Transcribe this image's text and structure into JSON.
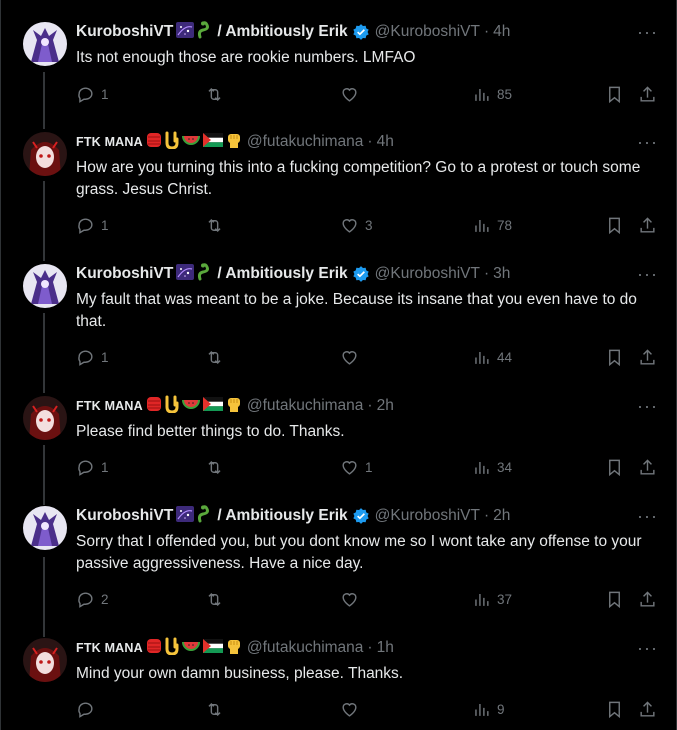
{
  "tweets": [
    {
      "author": "KuroboshiVT",
      "author_suffix": "/ Ambitiously Erik",
      "handle": "@KuroboshiVT",
      "time": "4h",
      "text": "Its not enough those are rookie numbers. LMFAO",
      "replies": "1",
      "retweets": "",
      "likes": "",
      "views": "85"
    },
    {
      "author": "FTK MANA",
      "author_suffix": "",
      "handle": "@futakuchimana",
      "time": "4h",
      "text": "How are you turning this into a fucking competition? Go to a protest or touch some grass. Jesus Christ.",
      "replies": "1",
      "retweets": "",
      "likes": "3",
      "views": "78"
    },
    {
      "author": "KuroboshiVT",
      "author_suffix": "/ Ambitiously Erik",
      "handle": "@KuroboshiVT",
      "time": "3h",
      "text": "My fault that was meant to be a joke. Because its insane that you even have to do that.",
      "replies": "1",
      "retweets": "",
      "likes": "",
      "views": "44"
    },
    {
      "author": "FTK MANA",
      "author_suffix": "",
      "handle": "@futakuchimana",
      "time": "2h",
      "text": "Please find better things to do. Thanks.",
      "replies": "1",
      "retweets": "",
      "likes": "1",
      "views": "34"
    },
    {
      "author": "KuroboshiVT",
      "author_suffix": "/ Ambitiously Erik",
      "handle": "@KuroboshiVT",
      "time": "2h",
      "text": "Sorry that I offended you, but you dont know me so I wont take any offense to your passive aggressiveness. Have a nice day.",
      "replies": "2",
      "retweets": "",
      "likes": "",
      "views": "37"
    },
    {
      "author": "FTK MANA",
      "author_suffix": "",
      "handle": "@futakuchimana",
      "time": "1h",
      "text": "Mind your own damn business, please. Thanks.",
      "replies": "",
      "retweets": "",
      "likes": "",
      "views": "9"
    }
  ],
  "ui": {
    "dot": "·",
    "more": "···"
  },
  "colors": {
    "verified": "#1d9bf0",
    "muted": "#71767b",
    "text": "#e7e9ea",
    "background": "#000000"
  },
  "icons": [
    "reply-icon",
    "retweet-icon",
    "like-icon",
    "views-icon",
    "bookmark-icon",
    "share-icon",
    "verified-badge-icon",
    "more-icon"
  ]
}
